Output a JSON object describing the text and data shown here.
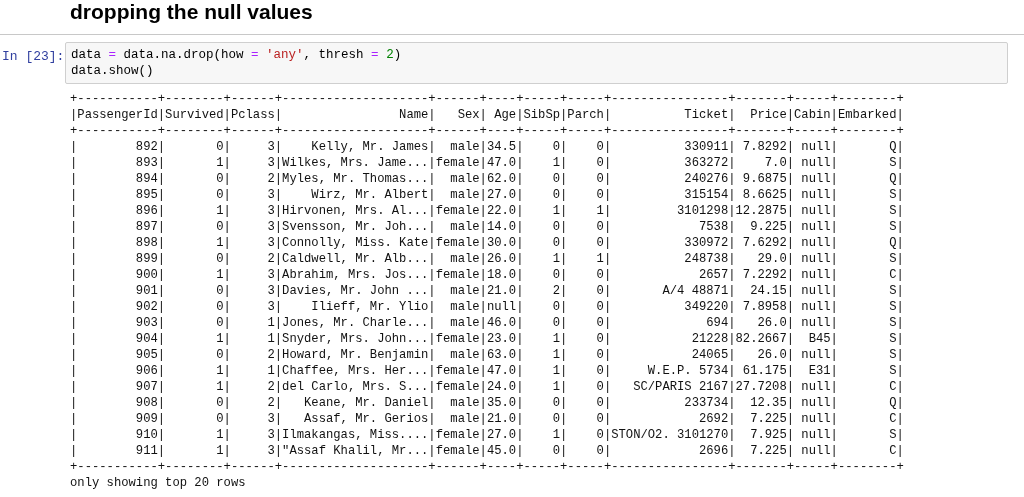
{
  "heading": "dropping the null values",
  "cell": {
    "prompt": "In [23]:",
    "code_lines": [
      [
        {
          "kind": "plain",
          "text": "data "
        },
        {
          "kind": "operator",
          "text": "="
        },
        {
          "kind": "plain",
          "text": " data.na.drop(how "
        },
        {
          "kind": "operator",
          "text": "= "
        },
        {
          "kind": "string",
          "text": "'any'"
        },
        {
          "kind": "plain",
          "text": ", thresh "
        },
        {
          "kind": "operator",
          "text": "= "
        },
        {
          "kind": "number",
          "text": "2"
        },
        {
          "kind": "plain",
          "text": ")"
        }
      ],
      [
        {
          "kind": "plain",
          "text": "data.show()"
        }
      ]
    ]
  },
  "output_lines": [
    "+-----------+--------+------+--------------------+------+----+-----+-----+----------------+-------+-----+--------+",
    "|PassengerId|Survived|Pclass|                Name|   Sex| Age|SibSp|Parch|          Ticket|  Price|Cabin|Embarked|",
    "+-----------+--------+------+--------------------+------+----+-----+-----+----------------+-------+-----+--------+",
    "|        892|       0|     3|    Kelly, Mr. James|  male|34.5|    0|    0|          330911| 7.8292| null|       Q|",
    "|        893|       1|     3|Wilkes, Mrs. Jame...|female|47.0|    1|    0|          363272|    7.0| null|       S|",
    "|        894|       0|     2|Myles, Mr. Thomas...|  male|62.0|    0|    0|          240276| 9.6875| null|       Q|",
    "|        895|       0|     3|    Wirz, Mr. Albert|  male|27.0|    0|    0|          315154| 8.6625| null|       S|",
    "|        896|       1|     3|Hirvonen, Mrs. Al...|female|22.0|    1|    1|         3101298|12.2875| null|       S|",
    "|        897|       0|     3|Svensson, Mr. Joh...|  male|14.0|    0|    0|            7538|  9.225| null|       S|",
    "|        898|       1|     3|Connolly, Miss. Kate|female|30.0|    0|    0|          330972| 7.6292| null|       Q|",
    "|        899|       0|     2|Caldwell, Mr. Alb...|  male|26.0|    1|    1|          248738|   29.0| null|       S|",
    "|        900|       1|     3|Abrahim, Mrs. Jos...|female|18.0|    0|    0|            2657| 7.2292| null|       C|",
    "|        901|       0|     3|Davies, Mr. John ...|  male|21.0|    2|    0|       A/4 48871|  24.15| null|       S|",
    "|        902|       0|     3|    Ilieff, Mr. Ylio|  male|null|    0|    0|          349220| 7.8958| null|       S|",
    "|        903|       0|     1|Jones, Mr. Charle...|  male|46.0|    0|    0|             694|   26.0| null|       S|",
    "|        904|       1|     1|Snyder, Mrs. John...|female|23.0|    1|    0|           21228|82.2667|  B45|       S|",
    "|        905|       0|     2|Howard, Mr. Benjamin|  male|63.0|    1|    0|           24065|   26.0| null|       S|",
    "|        906|       1|     1|Chaffee, Mrs. Her...|female|47.0|    1|    0|     W.E.P. 5734| 61.175|  E31|       S|",
    "|        907|       1|     2|del Carlo, Mrs. S...|female|24.0|    1|    0|   SC/PARIS 2167|27.7208| null|       C|",
    "|        908|       0|     2|   Keane, Mr. Daniel|  male|35.0|    0|    0|          233734|  12.35| null|       Q|",
    "|        909|       0|     3|   Assaf, Mr. Gerios|  male|21.0|    0|    0|            2692|  7.225| null|       C|",
    "|        910|       1|     3|Ilmakangas, Miss....|female|27.0|    1|    0|STON/O2. 3101270|  7.925| null|       S|",
    "|        911|       1|     3|\"Assaf Khalil, Mr...|female|45.0|    0|    0|            2696|  7.225| null|       C|",
    "+-----------+--------+------+--------------------+------+----+-----+-----+----------------+-------+-----+--------+",
    "only showing top 20 rows"
  ]
}
